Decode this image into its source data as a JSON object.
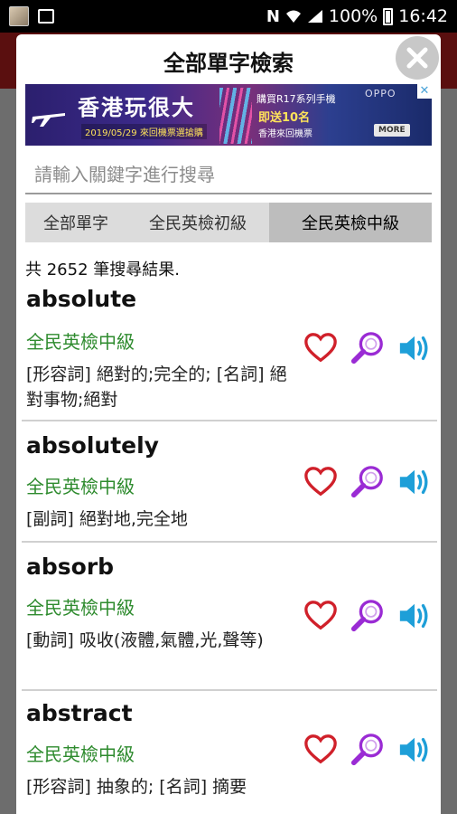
{
  "status_bar": {
    "battery": "100%",
    "time": "16:42",
    "network_letter": "N"
  },
  "dialog": {
    "title": "全部單字檢索"
  },
  "ad": {
    "headline": "香港玩很大",
    "subline": "2019/05/29 來回機票選搶購",
    "line1": "購買R17系列手機",
    "line2": "即送10名",
    "line3": "香港來回機票",
    "brand": "OPPO",
    "more_label": "MORE",
    "close_glyph": "✕"
  },
  "search": {
    "placeholder": "請輸入關鍵字進行搜尋",
    "value": ""
  },
  "tabs": [
    {
      "label": "全部單字",
      "selected": false
    },
    {
      "label": "全民英檢初級",
      "selected": false
    },
    {
      "label": "全民英檢中級",
      "selected": true
    }
  ],
  "result_count": "共 2652 筆搜尋結果.",
  "entries": [
    {
      "word": "absolute",
      "level": "全民英檢中級",
      "definition": "[形容詞] 絕對的;完全的; [名詞] 絕對事物;絕對"
    },
    {
      "word": "absolutely",
      "level": "全民英檢中級",
      "definition": "[副詞] 絕對地,完全地"
    },
    {
      "word": "absorb",
      "level": "全民英檢中級",
      "definition": "[動詞] 吸收(液體,氣體,光,聲等)"
    },
    {
      "word": "abstract",
      "level": "全民英檢中級",
      "definition": "[形容詞] 抽象的; [名詞] 摘要"
    }
  ],
  "colors": {
    "heart": "#d0202a",
    "search": "#9a2bd4",
    "speaker": "#1e9fd8",
    "level_text": "#2e8b2e"
  },
  "icons": [
    "heart-icon",
    "magnifier-icon",
    "speaker-icon"
  ]
}
